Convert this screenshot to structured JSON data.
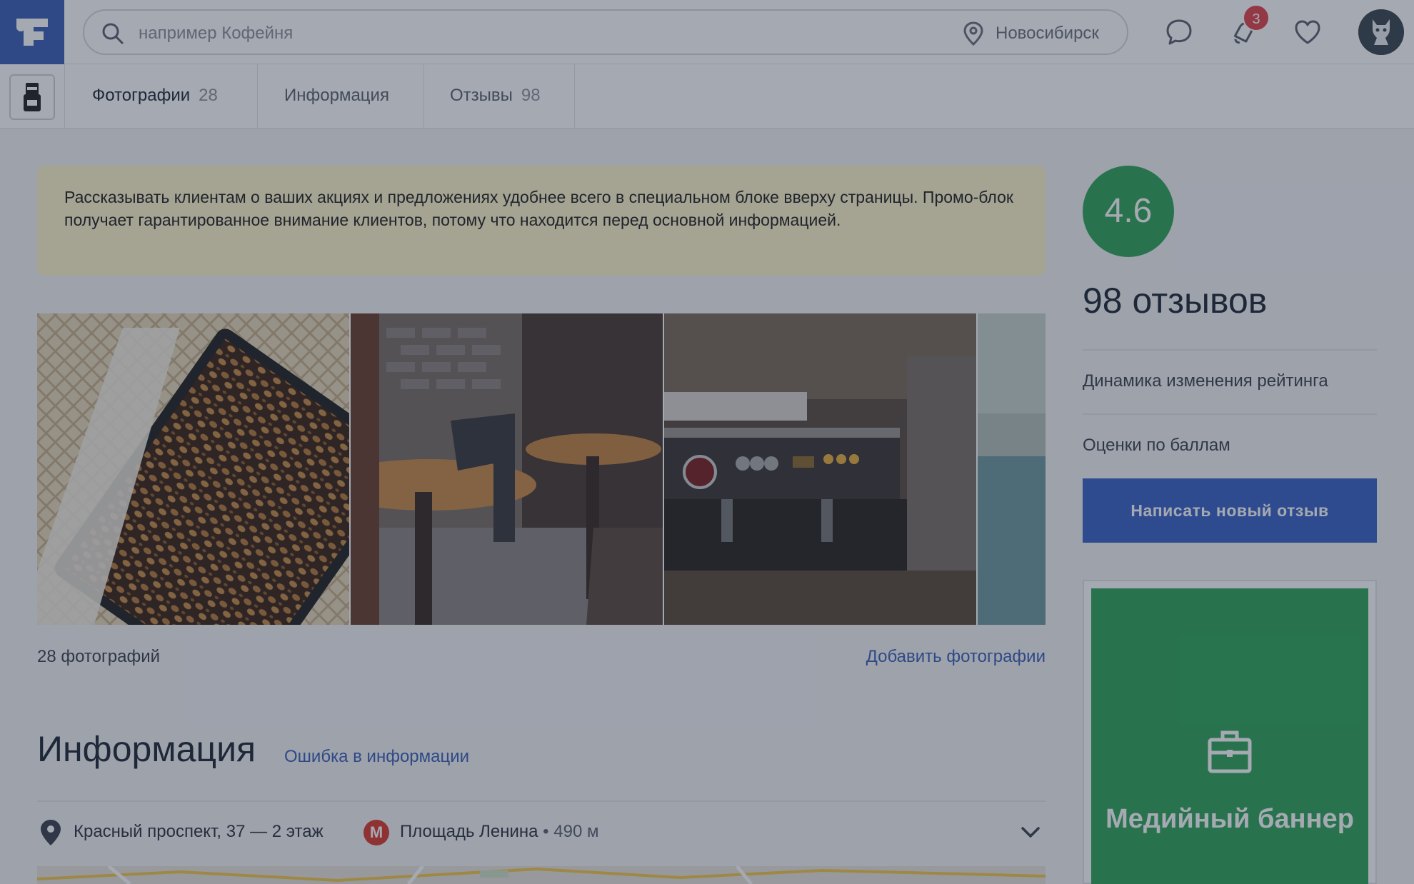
{
  "header": {
    "search_placeholder": "например Кофейня",
    "city": "Новосибирск",
    "notifications_count": "3"
  },
  "tabs": [
    {
      "label": "Фотографии",
      "count": "28"
    },
    {
      "label": "Информация",
      "count": ""
    },
    {
      "label": "Отзывы",
      "count": "98"
    }
  ],
  "notice": {
    "text": "Рассказывать клиентам о ваших акциях и предложениях удобнее всего в специальном блоке вверху страницы. Промо-блок получает гарантированное внимание клиентов, потому что находится перед основной информацией."
  },
  "photos": {
    "count_label": "28 фотографий",
    "add_label": "Добавить фотографии"
  },
  "info": {
    "title": "Информация",
    "error_link": "Ошибка в информации",
    "address": "Красный проспект, 37 — 2 этаж",
    "metro_letter": "М",
    "metro_name": "Площадь Ленина",
    "metro_distance": "• 490 м"
  },
  "sidebar": {
    "rating": "4.6",
    "reviews_count": "98 отзывов",
    "rating_dynamics": "Динамика изменения рейтинга",
    "score_breakdown": "Оценки по баллам",
    "write_review": "Написать новый отзыв",
    "banner_text": "Медийный баннер"
  },
  "colors": {
    "brand": "#3a5fb8",
    "rating_green": "#2fa65a",
    "notice_bg": "#fff6cc",
    "badge_red": "#e0454c",
    "metro_red": "#d93a2f"
  }
}
